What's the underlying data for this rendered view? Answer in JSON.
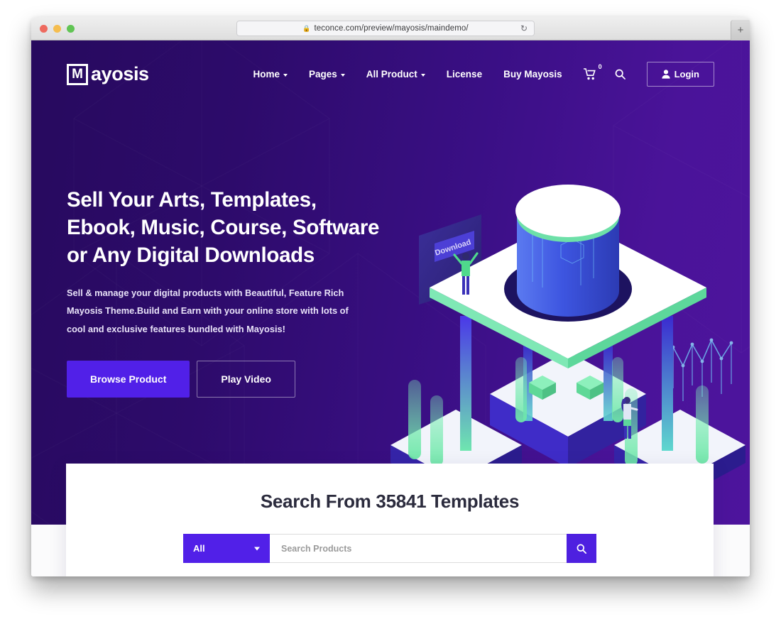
{
  "browser": {
    "url": "teconce.com/preview/mayosis/maindemo/",
    "lock_icon": "lock-icon",
    "reload_icon": "reload-icon",
    "new_tab_label": "+",
    "traffic_lights": [
      "close",
      "minimize",
      "zoom"
    ]
  },
  "site": {
    "logo_mark": "M",
    "logo_text": "ayosis"
  },
  "nav": {
    "links": [
      {
        "label": "Home",
        "has_dropdown": true
      },
      {
        "label": "Pages",
        "has_dropdown": true
      },
      {
        "label": "All Product",
        "has_dropdown": true
      },
      {
        "label": "License",
        "has_dropdown": false
      },
      {
        "label": "Buy Mayosis",
        "has_dropdown": false
      }
    ],
    "cart_count": "0",
    "cart_icon": "shopping-cart-icon",
    "search_icon": "search-icon",
    "login_label": "Login",
    "login_icon": "user-icon"
  },
  "hero": {
    "title": "Sell Your Arts, Templates, Ebook, Music, Course, Software or Any Digital Downloads",
    "subtitle": "Sell & manage your digital products with Beautiful, Feature Rich Mayosis Theme.Build and Earn with your online store with lots of cool and exclusive features bundled with Mayosis!",
    "primary_button": "Browse Product",
    "secondary_button": "Play Video",
    "illustration_label": "Download"
  },
  "search_section": {
    "heading": "Search From 35841 Templates",
    "category_selected": "All",
    "input_placeholder": "Search Products",
    "submit_icon": "search-icon"
  },
  "colors": {
    "hero_gradient_start": "#270a5e",
    "hero_gradient_end": "#4d149d",
    "accent_purple": "#5120e8",
    "submit_purple": "#4e20e0",
    "heading_dark": "#2b2b3d",
    "illustration_green": "#6ee7a8",
    "illustration_blue": "#3b4fd8"
  }
}
